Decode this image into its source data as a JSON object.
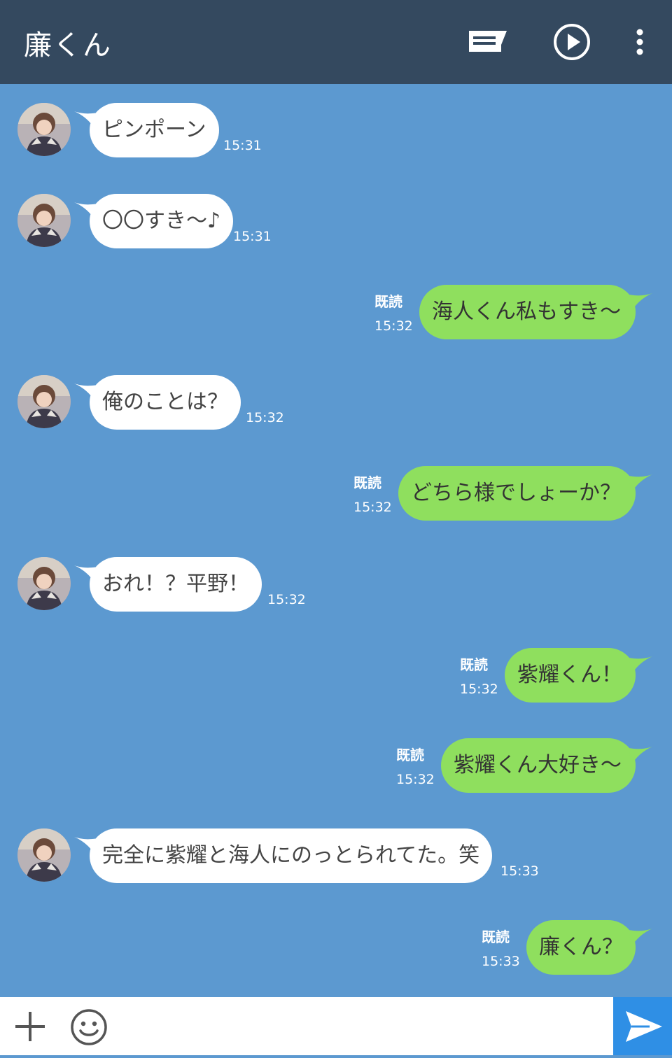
{
  "header": {
    "title": "廉くん"
  },
  "icons": {
    "note": "note-icon",
    "play": "play-icon",
    "menu": "more-vertical-icon",
    "add": "plus-icon",
    "emoji": "smile-icon",
    "send": "send-icon"
  },
  "colors": {
    "header_bg": "#34495f",
    "chat_bg": "#5c99d0",
    "incoming_bubble": "#ffffff",
    "outgoing_bubble": "#8fdf5e",
    "send_button": "#2f8fe5"
  },
  "messages": [
    {
      "direction": "in",
      "text": "ピンポーン",
      "time": "15:31"
    },
    {
      "direction": "in",
      "text": "〇〇すき〜♪",
      "time": "15:31"
    },
    {
      "direction": "out",
      "text": "海人くん私もすき〜",
      "time": "15:32",
      "read": "既読"
    },
    {
      "direction": "in",
      "text": "俺のことは？",
      "time": "15:32"
    },
    {
      "direction": "out",
      "text": "どちら様でしょーか？",
      "time": "15:32",
      "read": "既読"
    },
    {
      "direction": "in",
      "text": "おれ！？平野！",
      "time": "15:32"
    },
    {
      "direction": "out",
      "text": "紫耀くん！",
      "time": "15:32",
      "read": "既読"
    },
    {
      "direction": "out",
      "text": "紫耀くん大好き〜",
      "time": "15:32",
      "read": "既読"
    },
    {
      "direction": "in",
      "text": "完全に紫耀と海人にのっとられてた。笑",
      "time": "15:33"
    },
    {
      "direction": "out",
      "text": "廉くん？",
      "time": "15:33",
      "read": "既読"
    }
  ]
}
